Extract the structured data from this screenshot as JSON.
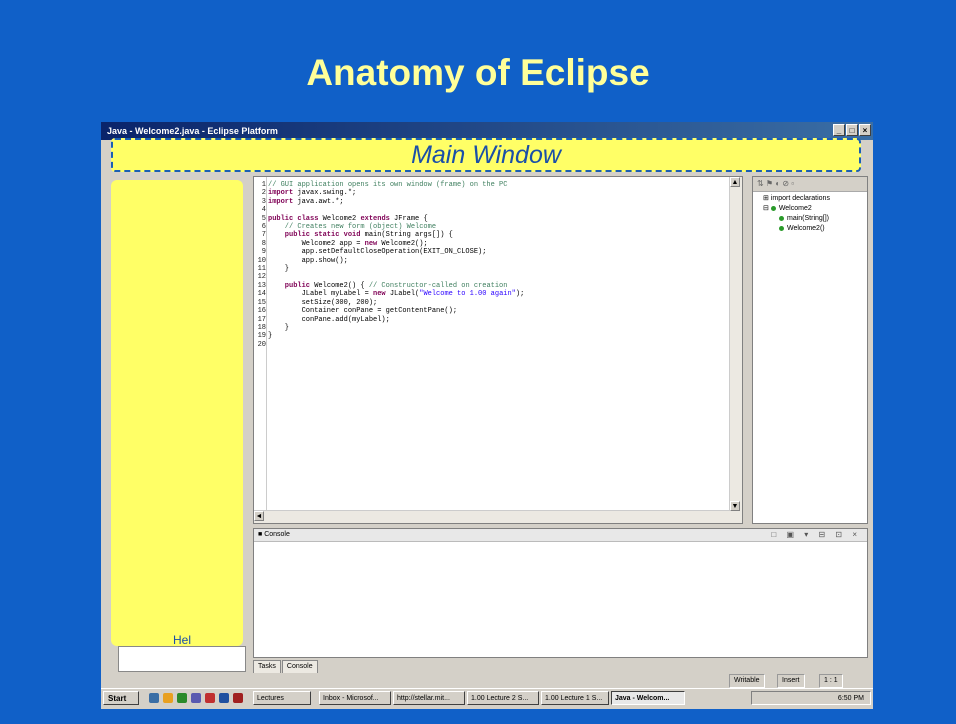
{
  "slide": {
    "title": "Anatomy of Eclipse"
  },
  "window": {
    "title": "Java - Welcome2.java - Eclipse Platform",
    "btn_min": "_",
    "btn_max": "□",
    "btn_close": "×"
  },
  "main_label": "Main Window",
  "editor_lines": [
    {
      "n": "1",
      "parts": [
        {
          "c": "cm",
          "t": "// GUI application opens its own window (frame) on the PC"
        }
      ]
    },
    {
      "n": "2",
      "parts": [
        {
          "c": "kw",
          "t": "import"
        },
        {
          "c": "",
          "t": " javax.swing.*;"
        }
      ]
    },
    {
      "n": "3",
      "parts": [
        {
          "c": "kw",
          "t": "import"
        },
        {
          "c": "",
          "t": " java.awt.*;"
        }
      ]
    },
    {
      "n": "4",
      "parts": []
    },
    {
      "n": "5",
      "parts": [
        {
          "c": "kw",
          "t": "public class"
        },
        {
          "c": "",
          "t": " Welcome2 "
        },
        {
          "c": "kw",
          "t": "extends"
        },
        {
          "c": "",
          "t": " JFrame {"
        }
      ]
    },
    {
      "n": "6",
      "parts": [
        {
          "c": "cm",
          "t": "    // Creates new form (object) Welcome"
        }
      ]
    },
    {
      "n": "7",
      "parts": [
        {
          "c": "kw",
          "t": "    public static void"
        },
        {
          "c": "",
          "t": " main(String args[]) {"
        }
      ]
    },
    {
      "n": "8",
      "parts": [
        {
          "c": "",
          "t": "        Welcome2 app = "
        },
        {
          "c": "kw",
          "t": "new"
        },
        {
          "c": "",
          "t": " Welcome2();"
        }
      ]
    },
    {
      "n": "9",
      "parts": [
        {
          "c": "",
          "t": "        app.setDefaultCloseOperation(EXIT_ON_CLOSE);"
        }
      ]
    },
    {
      "n": "10",
      "parts": [
        {
          "c": "",
          "t": "        app.show();"
        }
      ]
    },
    {
      "n": "11",
      "parts": [
        {
          "c": "",
          "t": "    }"
        }
      ]
    },
    {
      "n": "12",
      "parts": []
    },
    {
      "n": "13",
      "parts": [
        {
          "c": "kw",
          "t": "    public"
        },
        {
          "c": "",
          "t": " Welcome2() { "
        },
        {
          "c": "cm",
          "t": "// Constructor-called on creation"
        }
      ]
    },
    {
      "n": "14",
      "parts": [
        {
          "c": "",
          "t": "        JLabel myLabel = "
        },
        {
          "c": "kw",
          "t": "new"
        },
        {
          "c": "",
          "t": " JLabel("
        },
        {
          "c": "st",
          "t": "\"Welcome to 1.00 again\""
        },
        {
          "c": "",
          "t": ");"
        }
      ]
    },
    {
      "n": "15",
      "parts": [
        {
          "c": "",
          "t": "        setSize(300, 200);"
        }
      ]
    },
    {
      "n": "16",
      "parts": [
        {
          "c": "",
          "t": "        Container conPane = getContentPane();"
        }
      ]
    },
    {
      "n": "17",
      "parts": [
        {
          "c": "",
          "t": "        conPane.add(myLabel);"
        }
      ]
    },
    {
      "n": "18",
      "parts": [
        {
          "c": "",
          "t": "    }"
        }
      ]
    },
    {
      "n": "19",
      "parts": [
        {
          "c": "",
          "t": "}"
        }
      ]
    },
    {
      "n": "20",
      "parts": []
    }
  ],
  "outline": {
    "items": [
      "import declarations",
      "Welcome2",
      "main(String[])",
      "Welcome2()"
    ]
  },
  "console": {
    "title": "Console",
    "tools": "□ ▣ ▾ ⊟ ⊡ ×"
  },
  "bottom_tabs": [
    "Tasks",
    "Console"
  ],
  "status": {
    "writable": "Writable",
    "insert": "Insert",
    "pos": "1 : 1"
  },
  "taskbar": {
    "start": "Start",
    "items": [
      "Lectures",
      "Inbox - Microsof...",
      "http://stellar.mit...",
      "1.00 Lecture 2 S...",
      "1.00 Lecture 1 S...",
      "Java - Welcom..."
    ],
    "clock": "6:50 PM"
  },
  "partial_text": "Hel",
  "colors": {
    "background": "#1060c8",
    "highlight": "#ffff66",
    "title": "#ffff99"
  }
}
